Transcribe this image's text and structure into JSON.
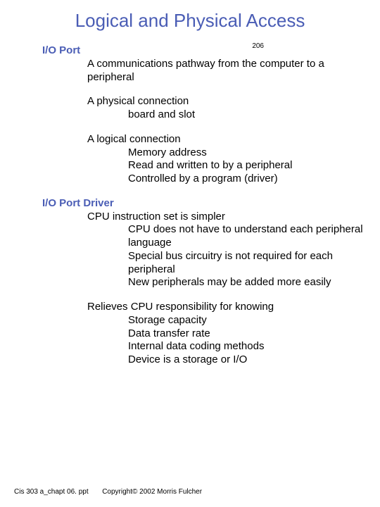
{
  "title": "Logical and Physical Access",
  "page_number": "206",
  "sections": [
    {
      "heading": "I/O Port",
      "blocks": [
        {
          "level": 1,
          "lines": [
            "A communications pathway from the computer to a peripheral"
          ]
        },
        {
          "level": 1,
          "lines": [
            "A physical connection"
          ],
          "sub": {
            "level": 2,
            "lines": [
              "board and slot"
            ]
          }
        },
        {
          "level": 1,
          "lines": [
            "A logical connection"
          ],
          "sub": {
            "level": 2,
            "lines": [
              "Memory address",
              "Read and written to by a peripheral",
              "Controlled by a program (driver)"
            ]
          }
        }
      ]
    },
    {
      "heading": "I/O Port Driver",
      "blocks": [
        {
          "level": 1,
          "lines": [
            "CPU instruction set is simpler"
          ],
          "sub": {
            "level": 2,
            "lines_long": [
              "CPU does not have to understand each peripheral language",
              "Special bus circuitry is not required for each peripheral",
              "New peripherals may be added more easily"
            ]
          }
        },
        {
          "level": 1,
          "lines": [
            "Relieves CPU responsibility for knowing"
          ],
          "sub": {
            "level": 2,
            "lines": [
              "Storage capacity",
              "Data transfer rate",
              "Internal data coding methods",
              "Device is a storage or I/O"
            ]
          }
        }
      ]
    }
  ],
  "footer": {
    "filename": "Cis 303 a_chapt 06. ppt",
    "copyright": "Copyright© 2002 Morris Fulcher"
  }
}
